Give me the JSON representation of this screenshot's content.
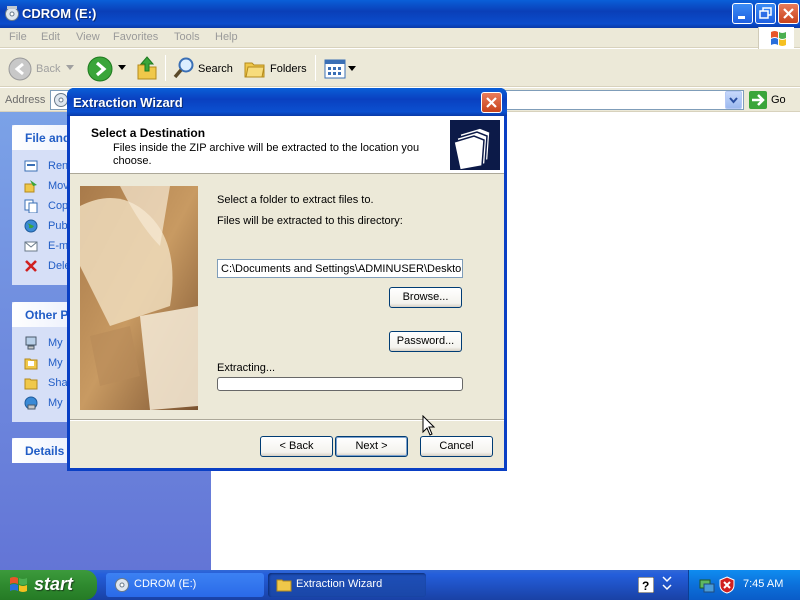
{
  "window": {
    "title": "CDROM (E:)"
  },
  "menu": [
    "File",
    "Edit",
    "View",
    "Favorites",
    "Tools",
    "Help"
  ],
  "toolbar": {
    "back_label": "Back",
    "search_label": "Search",
    "folders_label": "Folders"
  },
  "address": {
    "label": "Address",
    "go_label": "Go"
  },
  "taskpane": {
    "file_tasks": {
      "title": "File and",
      "items": [
        "Ren",
        "Mov",
        "Cop",
        "Pub",
        "E-m",
        "Dele"
      ]
    },
    "other_places": {
      "title": "Other P",
      "items": [
        "My",
        "My",
        "Sha",
        "My"
      ]
    },
    "details": {
      "title": "Details"
    }
  },
  "dialog": {
    "title": "Extraction Wizard",
    "header_title": "Select a Destination",
    "header_subtitle": "Files inside the ZIP archive will be extracted to the location you choose.",
    "instruction": "Select a folder to extract files to.",
    "directory_label": "Files will be extracted to this directory:",
    "directory_value": "C:\\Documents and Settings\\ADMINUSER\\Deskto",
    "browse_label": "Browse...",
    "password_label": "Password...",
    "extracting_label": "Extracting...",
    "progress": 0,
    "back_label": "< Back",
    "next_label": "Next >",
    "cancel_label": "Cancel"
  },
  "taskbar": {
    "start_label": "start",
    "tasks": [
      "CDROM (E:)",
      "Extraction Wizard"
    ],
    "clock": "7:45 AM"
  },
  "colors": {
    "titlebar_blue": "#0a4fd0",
    "taskbar_blue": "#245edb",
    "start_green": "#2f8a2f",
    "taskpane_blue": "#7ba2e7",
    "link_blue": "#215dc6"
  }
}
